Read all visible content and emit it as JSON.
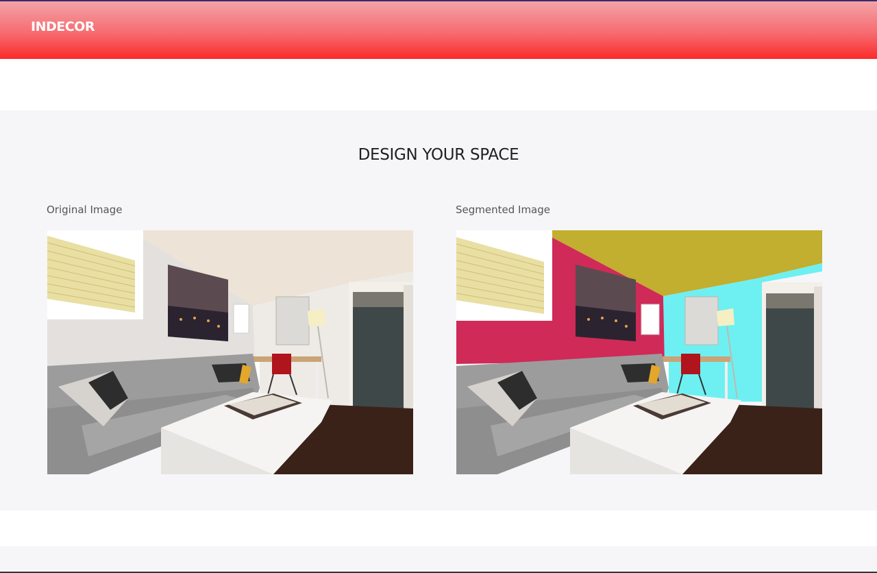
{
  "header": {
    "brand": "INDECOR"
  },
  "main": {
    "title": "DESIGN YOUR SPACE",
    "original": {
      "label": "Original Image"
    },
    "segmented": {
      "label": "Segmented Image"
    }
  },
  "colors": {
    "header_top": "#f3a3a8",
    "header_bottom": "#fb2a2a",
    "section_bg": "#f6f6f8",
    "seg_wall_left": "#d02a58",
    "seg_ceiling": "#c2ae2f",
    "seg_wall_right": "#6ef0f2"
  }
}
